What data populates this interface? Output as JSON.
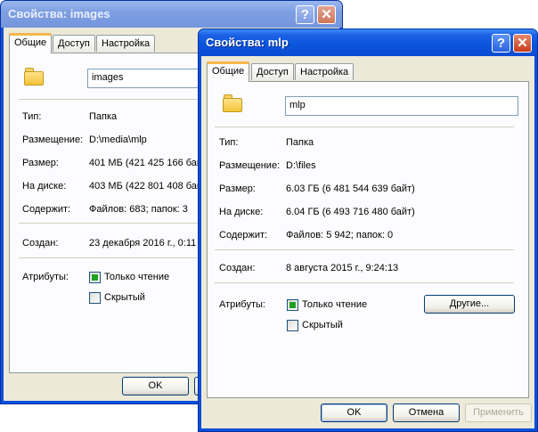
{
  "back_window": {
    "title": "Свойства: images",
    "tabs": [
      "Общие",
      "Доступ",
      "Настройка"
    ],
    "name_value": "images",
    "rows": [
      {
        "label": "Тип:",
        "value": "Папка"
      },
      {
        "label": "Размещение:",
        "value": "D:\\media\\mlp"
      },
      {
        "label": "Размер:",
        "value": "401 МБ (421 425 166 бай"
      },
      {
        "label": "На диске:",
        "value": "403 МБ (422 801 408 бай"
      },
      {
        "label": "Содержит:",
        "value": "Файлов: 683; папок: 3"
      },
      {
        "label": "Создан:",
        "value": "23 декабря 2016 г., 0:11"
      }
    ],
    "attributes_label": "Атрибуты:",
    "readonly_label": "Только чтение",
    "hidden_label": "Скрытый",
    "ok_label": "OK"
  },
  "front_window": {
    "title": "Свойства: mlp",
    "tabs": [
      "Общие",
      "Доступ",
      "Настройка"
    ],
    "name_value": "mlp",
    "rows": [
      {
        "label": "Тип:",
        "value": "Папка"
      },
      {
        "label": "Размещение:",
        "value": "D:\\files"
      },
      {
        "label": "Размер:",
        "value": "6.03 ГБ (6 481 544 639 байт)"
      },
      {
        "label": "На диске:",
        "value": "6.04 ГБ (6 493 716 480 байт)"
      },
      {
        "label": "Содержит:",
        "value": "Файлов: 5 942; папок: 0"
      },
      {
        "label": "Создан:",
        "value": "8 августа 2015 г., 9:24:13"
      }
    ],
    "attributes_label": "Атрибуты:",
    "readonly_label": "Только чтение",
    "readonly_checked": true,
    "hidden_label": "Скрытый",
    "hidden_checked": false,
    "other_button": "Другие...",
    "ok_label": "OK",
    "cancel_label": "Отмена",
    "apply_label": "Применить"
  },
  "title_buttons": {
    "help": "?",
    "close": "✕"
  },
  "icons": {
    "folder": "folder-icon",
    "help": "help-icon",
    "close": "close-icon"
  },
  "colors": {
    "titlebar_active": "#0a55dd",
    "titlebar_inactive": "#7fa0e2",
    "dialog_bg": "#ece9d8",
    "tab_highlight": "#f6b74a",
    "checkbox_mark": "#21a121"
  }
}
